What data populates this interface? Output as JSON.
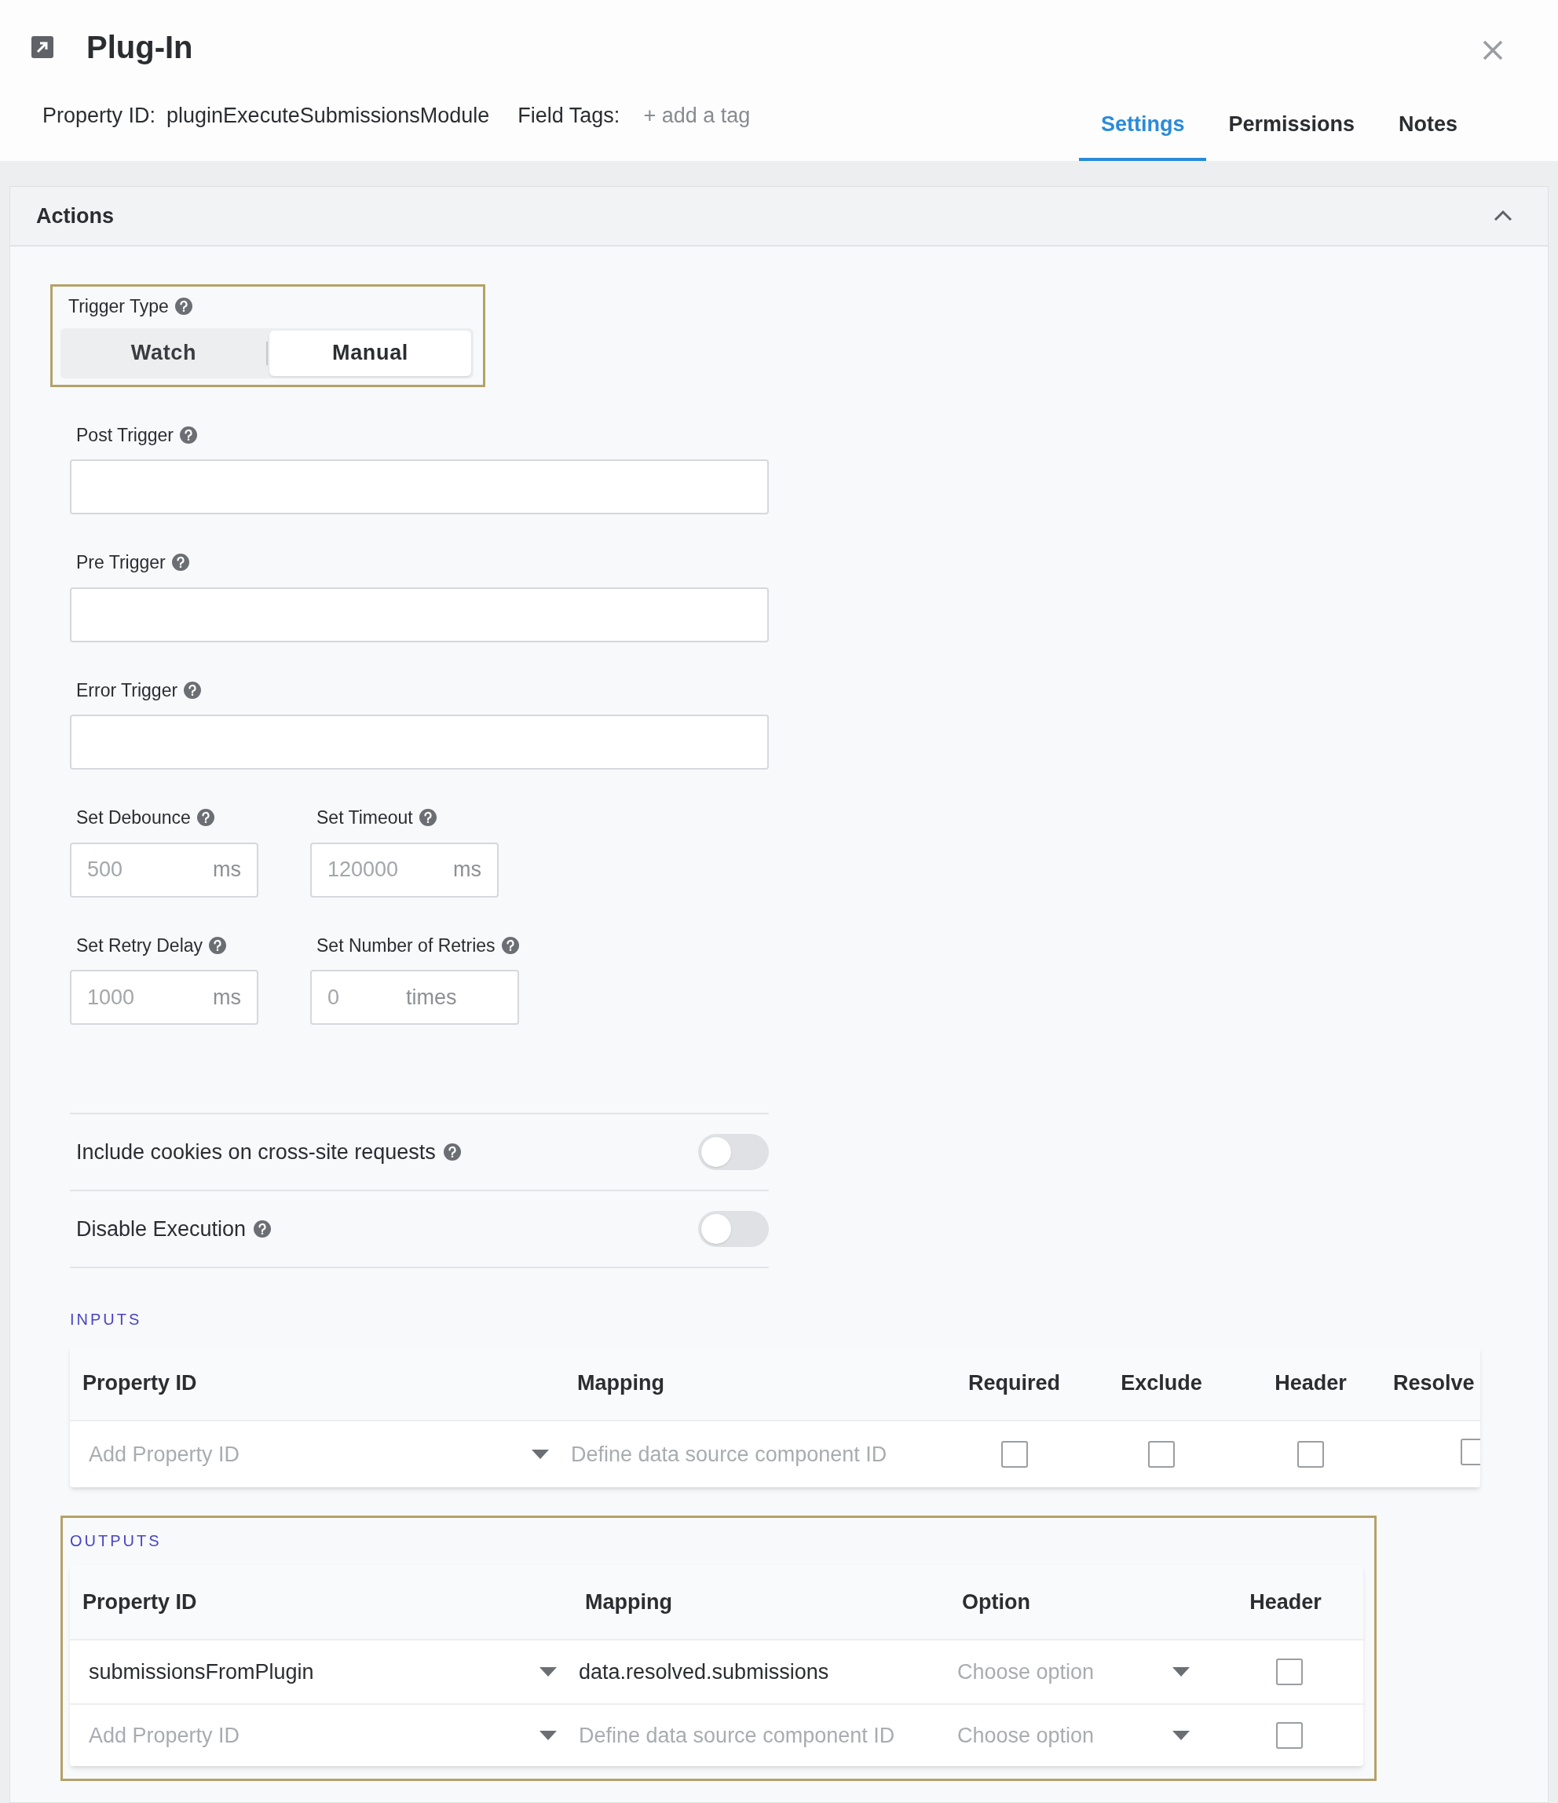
{
  "header": {
    "title": "Plug-In",
    "property_id_label": "Property ID:",
    "property_id": "pluginExecuteSubmissionsModule",
    "field_tags_label": "Field Tags:",
    "add_tag": "+ add a tag"
  },
  "tabs": [
    {
      "label": "Settings",
      "selected": true
    },
    {
      "label": "Permissions",
      "selected": false
    },
    {
      "label": "Notes",
      "selected": false
    }
  ],
  "section": {
    "title": "Actions",
    "expanded": true
  },
  "trigger_type": {
    "label": "Trigger Type",
    "options": [
      {
        "label": "Watch",
        "selected": false
      },
      {
        "label": "Manual",
        "selected": true
      }
    ]
  },
  "text_fields": [
    {
      "label": "Post Trigger"
    },
    {
      "label": "Pre Trigger"
    },
    {
      "label": "Error Trigger"
    }
  ],
  "number_fields": [
    [
      {
        "label": "Set Debounce",
        "placeholder": "500",
        "unit": "ms"
      },
      {
        "label": "Set Timeout",
        "placeholder": "120000",
        "unit": "ms"
      }
    ],
    [
      {
        "label": "Set Retry Delay",
        "placeholder": "1000",
        "unit": "ms"
      },
      {
        "label": "Set Number of Retries",
        "placeholder": "0",
        "unit": "times"
      }
    ]
  ],
  "toggles": [
    {
      "label": "Include cookies on cross-site requests",
      "on": false
    },
    {
      "label": "Disable Execution",
      "on": false
    }
  ],
  "inputs": {
    "title": "INPUTS",
    "columns": [
      "Property ID",
      "Mapping",
      "Required",
      "Exclude",
      "Header",
      "Resolve"
    ],
    "rows": [
      {
        "property_id_placeholder": "Add Property ID",
        "mapping_placeholder": "Define data source component ID",
        "checks": [
          {
            "checked": false
          },
          {
            "checked": false
          },
          {
            "checked": false
          },
          {
            "checked": false
          }
        ]
      }
    ]
  },
  "outputs": {
    "title": "OUTPUTS",
    "columns": [
      "Property ID",
      "Mapping",
      "Option",
      "Header"
    ],
    "rows": [
      {
        "property_id": "submissionsFromPlugin",
        "mapping": "data.resolved.submissions",
        "option_placeholder": "Choose option",
        "header_checked": false
      },
      {
        "property_id_placeholder": "Add Property ID",
        "mapping_placeholder": "Define data source component ID",
        "option_placeholder": "Choose option",
        "header_checked": false
      }
    ]
  }
}
